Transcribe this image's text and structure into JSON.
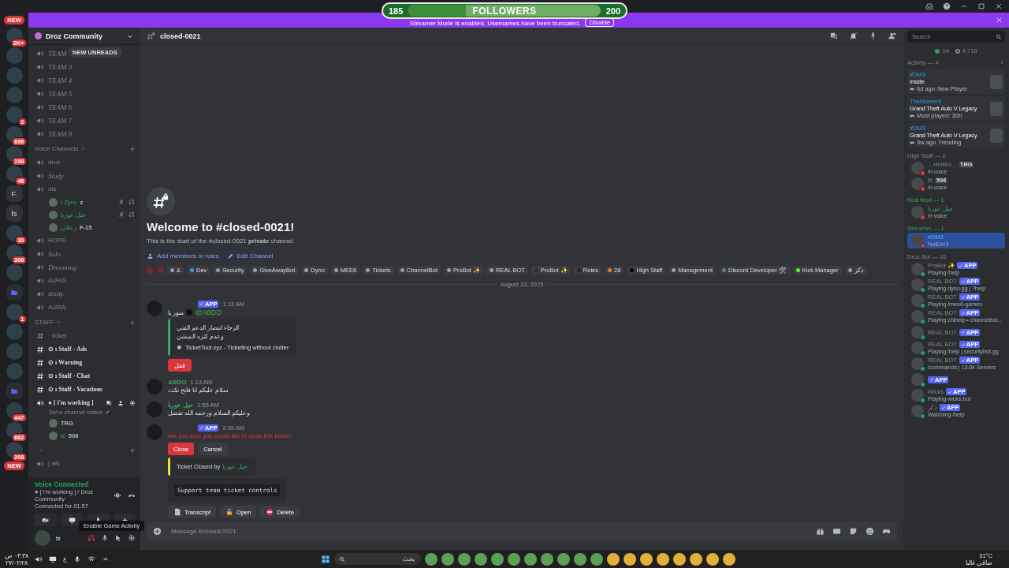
{
  "followers": {
    "start": "185",
    "label": "FOLLOWERS",
    "end": "200",
    "level": 0.3
  },
  "banner": {
    "text": "Streamer Mode is enabled. Usernames have been truncated.",
    "button": "Disable"
  },
  "servers": [
    {
      "kind": "new",
      "label": "NEW"
    },
    {
      "kind": "avatar",
      "badge": "2K+"
    },
    {
      "kind": "avatar"
    },
    {
      "kind": "avatar"
    },
    {
      "kind": "avatar"
    },
    {
      "kind": "avatar",
      "badge": "2"
    },
    {
      "kind": "avatar",
      "badge": "696"
    },
    {
      "kind": "avatar",
      "badge": "198"
    },
    {
      "kind": "avatar",
      "badge": "46"
    },
    {
      "kind": "text",
      "label": "F."
    },
    {
      "kind": "text",
      "label": "fs"
    },
    {
      "kind": "avatar",
      "badge": "30"
    },
    {
      "kind": "avatar",
      "badge": "306"
    },
    {
      "kind": "avatar"
    },
    {
      "kind": "folder"
    },
    {
      "kind": "avatar",
      "badge": "1"
    },
    {
      "kind": "avatar"
    },
    {
      "kind": "avatar"
    },
    {
      "kind": "avatar"
    },
    {
      "kind": "folder"
    },
    {
      "kind": "avatar",
      "badge": "447"
    },
    {
      "kind": "avatar",
      "badge": "662"
    },
    {
      "kind": "avatar",
      "badge": "208"
    },
    {
      "kind": "new",
      "label": "NEW"
    }
  ],
  "sidebar": {
    "server_name": "Droz Community",
    "new_unreads": "NEW UNREADS",
    "sections": [
      {
        "channels": [
          {
            "kind": "voice",
            "name": "TEAM",
            "italic": true,
            "unread": false
          },
          {
            "kind": "voice",
            "name": "TEAM 3",
            "italic": true,
            "unread": false
          },
          {
            "kind": "voice",
            "name": "TEAM 4",
            "italic": true,
            "unread": false
          },
          {
            "kind": "voice",
            "name": "TEAM 5",
            "italic": true,
            "unread": false
          },
          {
            "kind": "voice",
            "name": "TEAM 6",
            "italic": true,
            "unread": false
          },
          {
            "kind": "voice",
            "name": "TEAM 7",
            "italic": true,
            "unread": false
          },
          {
            "kind": "voice",
            "name": "TEAM 8",
            "italic": true,
            "unread": false
          }
        ]
      },
      {
        "header": "Voice Channels",
        "channels": [
          {
            "kind": "voice",
            "name": "droz",
            "italic": false,
            "unread": false
          },
          {
            "kind": "voice",
            "name": "Study",
            "italic": true,
            "unread": false
          },
          {
            "kind": "voice",
            "name": "ols",
            "italic": false,
            "unread": false,
            "members": [
              {
                "name": "I Zynx",
                "tag": "z",
                "muted": true,
                "deafened": true
              },
              {
                "name": "حيل عوربا",
                "muted": true,
                "deafened": true
              },
              {
                "name": "زعلان",
                "tag": "F-15",
                "muted": false,
                "deafened": false
              }
            ]
          },
          {
            "kind": "voice",
            "name": "HOPE.",
            "italic": false,
            "unread": false
          },
          {
            "kind": "voice",
            "name": "Solo",
            "italic": true,
            "unread": false
          },
          {
            "kind": "voice",
            "name": "Dreaming",
            "italic": true,
            "unread": false
          },
          {
            "kind": "voice",
            "name": "AURA.",
            "italic": false,
            "unread": false
          },
          {
            "kind": "voice",
            "name": "study.",
            "italic": false,
            "unread": false
          },
          {
            "kind": "voice",
            "name": "AURA.",
            "italic": false,
            "unread": false
          }
        ]
      },
      {
        "header": "STAFF",
        "channels": [
          {
            "kind": "text",
            "name": "· ticket",
            "italic": false,
            "unread": false
          },
          {
            "kind": "text",
            "name": "⊙ ı Staff · Ads",
            "italic": false,
            "unread": true
          },
          {
            "kind": "text",
            "name": "⊙ ı Warning",
            "italic": false,
            "unread": true
          },
          {
            "kind": "text",
            "name": "⊙ ı Staff · Chat",
            "italic": false,
            "unread": true
          },
          {
            "kind": "text",
            "name": "⊙ ı Staff · Vacations",
            "italic": false,
            "unread": true
          },
          {
            "kind": "voice",
            "name": "● [ i'm working ]",
            "italic": false,
            "unread": true,
            "status": "Set a channel status",
            "members": [
              {
                "tag": "TRG",
                "muted": false,
                "deafened": false
              },
              {
                "name": "fz",
                "tag": "506",
                "muted": false,
                "deafened": false
              }
            ]
          }
        ]
      },
      {
        "header": ".",
        "channels": [
          {
            "kind": "voice",
            "name": "| afk",
            "italic": false,
            "unread": false
          }
        ]
      }
    ]
  },
  "voice_panel": {
    "title": "Voice Connected",
    "channel": "● [ i'm working ] / Droz Community",
    "duration": "Connected for 01:57",
    "tooltip": "Enable Game Activity",
    "user": "fz",
    "deafened": true
  },
  "channel": {
    "name": "closed-0021",
    "welcome_title": "Welcome to #closed-0021!",
    "welcome_text": "This is the start of the #closed-0021 **private** channel.",
    "actions": [
      "Add members or roles",
      "Edit Channel"
    ]
  },
  "roles": [
    {
      "name": "&",
      "color": "#9aa0a6"
    },
    {
      "name": "Dev",
      "color": "#3498db"
    },
    {
      "name": "Security",
      "color": "#9aa0a6"
    },
    {
      "name": "GiveAwayBot",
      "color": "#9aa0a6"
    },
    {
      "name": "Dyno",
      "color": "#9aa0a6"
    },
    {
      "name": "MEE6",
      "color": "#9aa0a6"
    },
    {
      "name": "Tickets",
      "color": "#9aa0a6"
    },
    {
      "name": "ChannelBot",
      "color": "#9aa0a6"
    },
    {
      "name": "ProBot ✨",
      "color": "#9aa0a6"
    },
    {
      "name": "REAL BOT",
      "color": "#9aa0a6"
    },
    {
      "name": "ProBot ✨",
      "color": "#4a1d4f"
    },
    {
      "name": "Roles",
      "color": "#23272a"
    },
    {
      "name": "28",
      "color": "#e67e22"
    },
    {
      "name": "High Staff",
      "color": "#000000"
    },
    {
      "name": "Management",
      "color": "#9aa0a6"
    },
    {
      "name": "Discord Developer 🛠",
      "color": "#607d8b"
    },
    {
      "name": "Kick Manager",
      "color": "#53fc18"
    },
    {
      "name": "ذكر",
      "color": "#9aa0a6"
    }
  ],
  "date_divider": "August 22, 2025",
  "messages": [
    {
      "app_tag": "APP",
      "time": "1:13 AM",
      "blocks": [
        {
          "kind": "text",
          "text": "متور يا",
          "mention": "@ABDO"
        },
        {
          "kind": "embed",
          "color": "#3ba55c",
          "lines": [
            "الرجاء انتصار الدعم الفني",
            "وعدم كثره المنشن"
          ],
          "footer": "TicketTool.xyz - Ticketing without clutter"
        },
        {
          "kind": "buttons",
          "buttons": [
            {
              "label": "قفل",
              "kind": "danger"
            }
          ]
        }
      ]
    },
    {
      "author": "ABDO",
      "time": "1:13 AM",
      "blocks": [
        {
          "kind": "text",
          "text": "سلام عليكم انا فاتح تكت"
        }
      ]
    },
    {
      "author": "حيل عوربا",
      "time": "1:55 AM",
      "blocks": [
        {
          "kind": "text",
          "text": "وعليكم السلام ورحمه الله تفضل"
        }
      ]
    },
    {
      "app_tag": "APP",
      "time": "2:39 AM",
      "blocks": [
        {
          "kind": "warning_text",
          "text": "Are you sure you would like to close this ticket?"
        },
        {
          "kind": "buttons",
          "buttons": [
            {
              "label": "Close",
              "kind": "danger"
            },
            {
              "label": "Cancel",
              "kind": "secondary"
            }
          ]
        },
        {
          "kind": "embed",
          "color": "#f0e130",
          "lines": [
            "Ticket Closed by"
          ],
          "mention": "حيل عوربا"
        },
        {
          "kind": "code",
          "text": "Support team ticket controls"
        },
        {
          "kind": "icon_buttons",
          "buttons": [
            {
              "label": "Transcript",
              "kind": "secondary"
            },
            {
              "label": "Open",
              "kind": "secondary"
            },
            {
              "label": "Delete",
              "kind": "secondary"
            }
          ]
        }
      ]
    }
  ],
  "composer": {
    "placeholder": "Message #closed-0021"
  },
  "member_list": {
    "search": {
      "placeholder": "Search"
    },
    "online": "14",
    "total": "4,715",
    "activity": {
      "title": "Activity — 4",
      "cards": [
        {
          "user": "#DM3",
          "title": "Inside",
          "meta": "6d ago",
          "extra": "New Player"
        },
        {
          "user": "TheMoment",
          "title": "Grand Theft Auto V Legacy",
          "meta": "Most played: 30h"
        },
        {
          "user": "#DM3",
          "title": "Grand Theft Auto V Legacy",
          "meta": "3w ago",
          "extra": "Trending"
        }
      ]
    },
    "groups": [
      {
        "title": "High Staff — 2",
        "kind": "plain",
        "members": [
          {
            "name": "ᛁ Hn!Rxl...",
            "tag": "TRG",
            "dnd": true,
            "activity": "In voice",
            "highlight": false
          },
          {
            "name": "fz",
            "tag": "506",
            "dnd": true,
            "activity": "In voice",
            "highlight": false
          }
        ]
      },
      {
        "title": "Kick Mod — 1",
        "kind": "green",
        "members": [
          {
            "name": "حيل عوربا",
            "dnd": true,
            "activity": "In voice",
            "highlight": false
          }
        ]
      },
      {
        "title": "Streamer — 1",
        "kind": "streamer",
        "members": [
          {
            "name": "#DM3",
            "dnd": true,
            "activity": "NotDm3",
            "highlight": true
          }
        ]
      },
      {
        "title": "Droz Bot — 10",
        "kind": "plain",
        "members": [
          {
            "name": "ProBot ✨",
            "app_tag": "APP",
            "dnd": false,
            "activity": "Playing /help",
            "highlight": false
          },
          {
            "name": "REAL BOT",
            "app_tag": "APP",
            "dnd": false,
            "activity": "Playing dyno.gg | ?help",
            "highlight": false
          },
          {
            "name": "REAL BOT",
            "app_tag": "APP",
            "dnd": false,
            "activity": "Playing /mee6-games",
            "highlight": false
          },
          {
            "name": "REAL BOT",
            "app_tag": "APP",
            "dnd": false,
            "activity": "Playing chlhelp • channelbot...",
            "highlight": false
          },
          {
            "name": "REAL BOT",
            "app_tag": "APP",
            "dnd": false,
            "highlight": false
          },
          {
            "name": "REAL BOT",
            "app_tag": "APP",
            "dnd": false,
            "activity": "Playing /help | securitybot.gg",
            "highlight": false
          },
          {
            "name": "REAL BOT",
            "app_tag": "APP",
            "dnd": false,
            "activity": "/commands | 13.0k Servers",
            "highlight": false
          },
          {
            "app_tag": "APP",
            "dnd": false,
            "highlight": false
          },
          {
            "name": "Wicks",
            "app_tag": "APP",
            "dnd": false,
            "activity": "Playing wicks.bot",
            "highlight": false
          },
          {
            "name": "ذكر",
            "app_tag": "APP",
            "dnd": false,
            "activity": "Watching /help",
            "highlight": false
          }
        ]
      }
    ]
  },
  "taskbar": {
    "time": "٠٣:٣٨ ص",
    "date": "٢٧/٠٢/٢٨",
    "language": "ع",
    "search": {
      "placeholder": "بحث"
    },
    "temperature": "31°C",
    "weather": "صافي غالبا"
  }
}
